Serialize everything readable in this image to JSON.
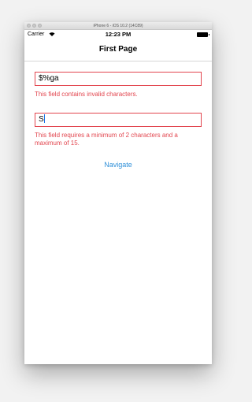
{
  "window": {
    "title": "iPhone 6 - iOS 10.2 (14C89)"
  },
  "status_bar": {
    "carrier": "Carrier",
    "time": "12:23 PM"
  },
  "nav_bar": {
    "title": "First Page"
  },
  "form": {
    "field1": {
      "value": "$%ga",
      "error": "This field contains invalid characters."
    },
    "field2": {
      "value": "S",
      "error": "This field requires a minimum of 2 characters and a maximum of 15."
    }
  },
  "navigate_label": "Navigate",
  "colors": {
    "error_red": "#e2454e",
    "link_blue": "#2e8fd8",
    "background": "#f2f2f2"
  },
  "icons": [
    "wifi-icon",
    "battery-icon"
  ]
}
